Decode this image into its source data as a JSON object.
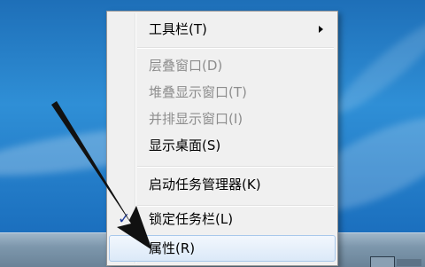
{
  "menu": {
    "items": [
      {
        "label": "工具栏(T)",
        "enabled": true,
        "submenu": true
      },
      {
        "label": "层叠窗口(D)",
        "enabled": false
      },
      {
        "label": "堆叠显示窗口(T)",
        "enabled": false
      },
      {
        "label": "并排显示窗口(I)",
        "enabled": false
      },
      {
        "label": "显示桌面(S)",
        "enabled": true
      },
      {
        "label": "启动任务管理器(K)",
        "enabled": true
      },
      {
        "label": "锁定任务栏(L)",
        "enabled": true,
        "checked": true,
        "check_glyph": "✓"
      },
      {
        "label": "属性(R)",
        "enabled": true,
        "highlighted": true
      }
    ]
  },
  "colors": {
    "menu_bg": "#f0f0f0",
    "disabled_text": "#8d8d8d",
    "highlight_border": "#a8c8eb",
    "annotation_arrow": "#111111"
  }
}
